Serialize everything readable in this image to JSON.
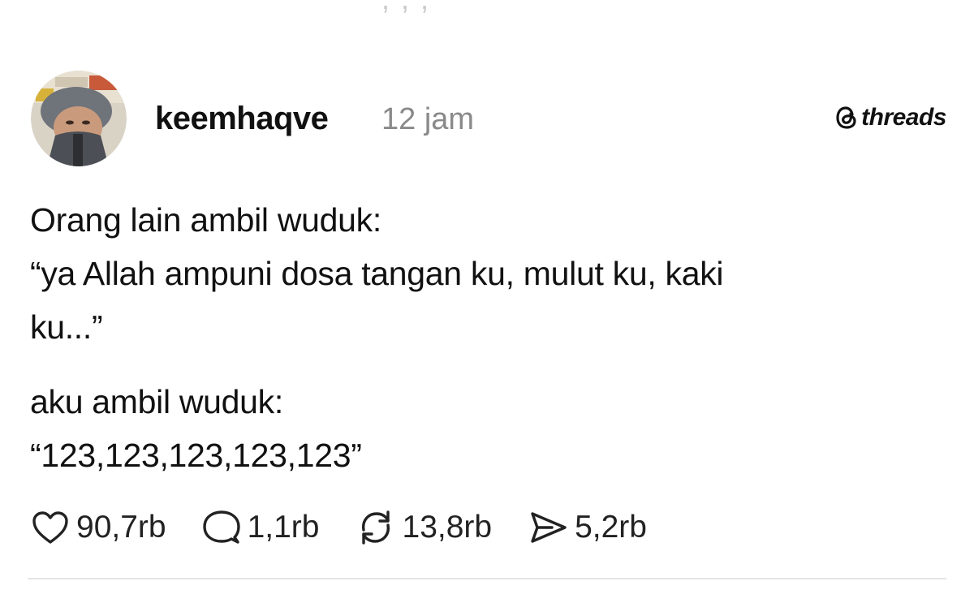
{
  "post": {
    "author": "keemhaqve",
    "timestamp": "12 jam",
    "brand": "threads",
    "lines_para1": [
      "Orang lain ambil wuduk:",
      "“ya Allah ampuni dosa tangan ku, mulut ku, kaki",
      "ku...”"
    ],
    "lines_para2": [
      "aku ambil wuduk:",
      "“123,123,123,123,123”"
    ]
  },
  "actions": {
    "likes": "90,7rb",
    "replies": "1,1rb",
    "reposts": "13,8rb",
    "shares": "5,2rb"
  },
  "icons": {
    "like": "heart-icon",
    "reply": "comment-bubble-icon",
    "repost": "repost-arrows-icon",
    "share": "send-icon",
    "brand": "threads-logo-icon"
  },
  "colors": {
    "text": "#111111",
    "muted": "#8a8a8a",
    "divider": "#e6e6e6"
  }
}
